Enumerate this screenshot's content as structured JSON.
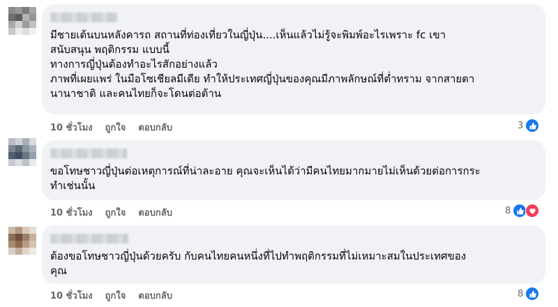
{
  "comments": [
    {
      "text_lines": [
        "มีชายเต้นบนหลังคารถ สถานที่ท่องเที่ยวในญี่ปุ่น....เห็นแล้วไม่รู้จะพิมพ์อะไรเพราะ fc เขา",
        "สนับสนุน พฤติกรรม แบบนี้",
        "ทางการญี่ปุ่นต้องทำอะไรสักอย่างแล้ว",
        "ภาพที่เผยแพร่ ในมือโซเชียลมีเดีย ทำให้ประเทศญี่ปุ่นของคุณมีภาพลักษณ์ที่ต่ำทราม จากสายตา",
        "นานาชาติ และคนไทยก็จะโดนต่อต้าน"
      ],
      "time": "10 ชั่วโมง",
      "like_label": "ถูกใจ",
      "reply_label": "ตอบกลับ",
      "reaction_count": "3",
      "reactions": [
        "like-icon"
      ]
    },
    {
      "text_lines": [
        "ขอโทษชาวญี่ปุ่นต่อเหตุการณ์ที่น่าละอาย คุณจะเห็นได้ว่ามีคนไทยมากมายไม่เห็นด้วยต่อการกระ",
        "ทำเช่นนั้น"
      ],
      "time": "10 ชั่วโมง",
      "like_label": "ถูกใจ",
      "reply_label": "ตอบกลับ",
      "reaction_count": "8",
      "reactions": [
        "like-icon",
        "love-icon"
      ]
    },
    {
      "text_lines": [
        "ต้องขอโทษชาวญี่ปุ่นด้วยครับ กับคนไทยคนหนึ่งที่ไปทำพฤติกรรมที่ไม่เหมาะสมในประเทศของ",
        "คุณ"
      ],
      "time": "10 ชั่วโมง",
      "like_label": "ถูกใจ",
      "reply_label": "ตอบกลับ",
      "reaction_count": "8",
      "reactions": [
        "like-icon"
      ]
    }
  ],
  "colors": {
    "bubble_bg": "#f0f2f5",
    "meta_text": "#65676b",
    "like_blue": "#1877f2",
    "love_red": "#f33e58"
  }
}
